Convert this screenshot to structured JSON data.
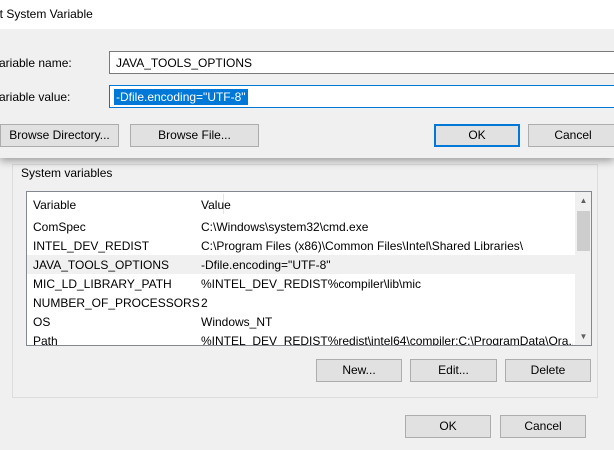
{
  "dialog": {
    "title": "Edit System Variable",
    "title_visible": "it System Variable",
    "name_label": "ariable name:",
    "value_label": "ariable value:",
    "name_value": "JAVA_TOOLS_OPTIONS",
    "value_value": "-Dfile.encoding=\"UTF-8\"",
    "browse_directory": "Browse Directory...",
    "browse_file": "Browse File...",
    "ok": "OK",
    "cancel": "Cancel"
  },
  "system_variables": {
    "group_title": "System variables",
    "columns": [
      "Variable",
      "Value"
    ],
    "rows": [
      {
        "variable": "ComSpec",
        "value": "C:\\Windows\\system32\\cmd.exe"
      },
      {
        "variable": "INTEL_DEV_REDIST",
        "value": "C:\\Program Files (x86)\\Common Files\\Intel\\Shared Libraries\\"
      },
      {
        "variable": "JAVA_TOOLS_OPTIONS",
        "value": "-Dfile.encoding=\"UTF-8\"",
        "selected": true
      },
      {
        "variable": "MIC_LD_LIBRARY_PATH",
        "value": "%INTEL_DEV_REDIST%compiler\\lib\\mic"
      },
      {
        "variable": "NUMBER_OF_PROCESSORS",
        "value": "2"
      },
      {
        "variable": "OS",
        "value": "Windows_NT"
      },
      {
        "variable": "Path",
        "value": "%INTEL_DEV_REDIST%redist\\intel64\\compiler;C:\\ProgramData\\Ora..."
      }
    ],
    "new_button": "New...",
    "edit_button": "Edit...",
    "delete_button": "Delete"
  },
  "footer": {
    "ok": "OK",
    "cancel": "Cancel"
  },
  "icons": {
    "scroll_up": "scroll-up-icon",
    "scroll_down": "scroll-down-icon"
  },
  "colors": {
    "accent": "#0078d7",
    "selection_text": "#ffffff"
  }
}
